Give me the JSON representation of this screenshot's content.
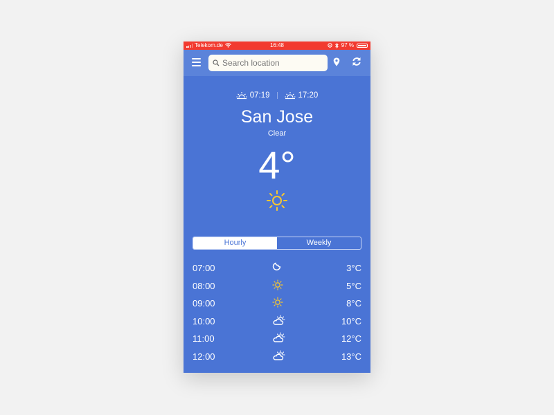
{
  "status_bar": {
    "carrier": "Telekom.de",
    "time": "16:48",
    "battery": "97 %"
  },
  "header": {
    "menu_icon": "hamburger-menu-icon",
    "search_placeholder": "Search location",
    "search_value": "",
    "location_icon": "map-pin-icon",
    "refresh_icon": "refresh-icon"
  },
  "sun": {
    "sunrise": "07:19",
    "sunset": "17:20"
  },
  "current": {
    "city": "San Jose",
    "condition": "Clear",
    "temperature": "4°",
    "icon": "sun-icon"
  },
  "tabs": [
    {
      "label": "Hourly",
      "active": true
    },
    {
      "label": "Weekly",
      "active": false
    }
  ],
  "hourly": [
    {
      "time": "07:00",
      "icon": "moon-icon",
      "temp": "3°C"
    },
    {
      "time": "08:00",
      "icon": "sun-icon",
      "temp": "5°C"
    },
    {
      "time": "09:00",
      "icon": "sun-icon",
      "temp": "8°C"
    },
    {
      "time": "10:00",
      "icon": "partly-cloudy-icon",
      "temp": "10°C"
    },
    {
      "time": "11:00",
      "icon": "partly-cloudy-icon",
      "temp": "12°C"
    },
    {
      "time": "12:00",
      "icon": "partly-cloudy-icon",
      "temp": "13°C"
    }
  ],
  "colors": {
    "background": "#4a74d5",
    "header": "#5b83da",
    "status_bar": "#f23a2f",
    "sun_yellow": "#f7c62f"
  }
}
